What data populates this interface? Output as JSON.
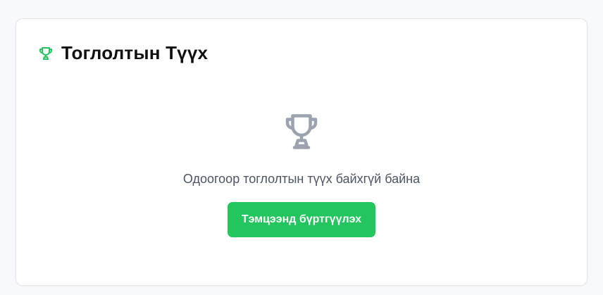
{
  "card": {
    "title": "Тоглолтын Түүх",
    "title_icon": "trophy-icon",
    "accent_color": "#22c55e"
  },
  "empty_state": {
    "icon": "trophy-icon",
    "icon_color": "#9ca3af",
    "message": "Одоогоор тоглолтын түүх байхгүй байна",
    "button_label": "Тэмцээнд бүртгүүлэх"
  }
}
